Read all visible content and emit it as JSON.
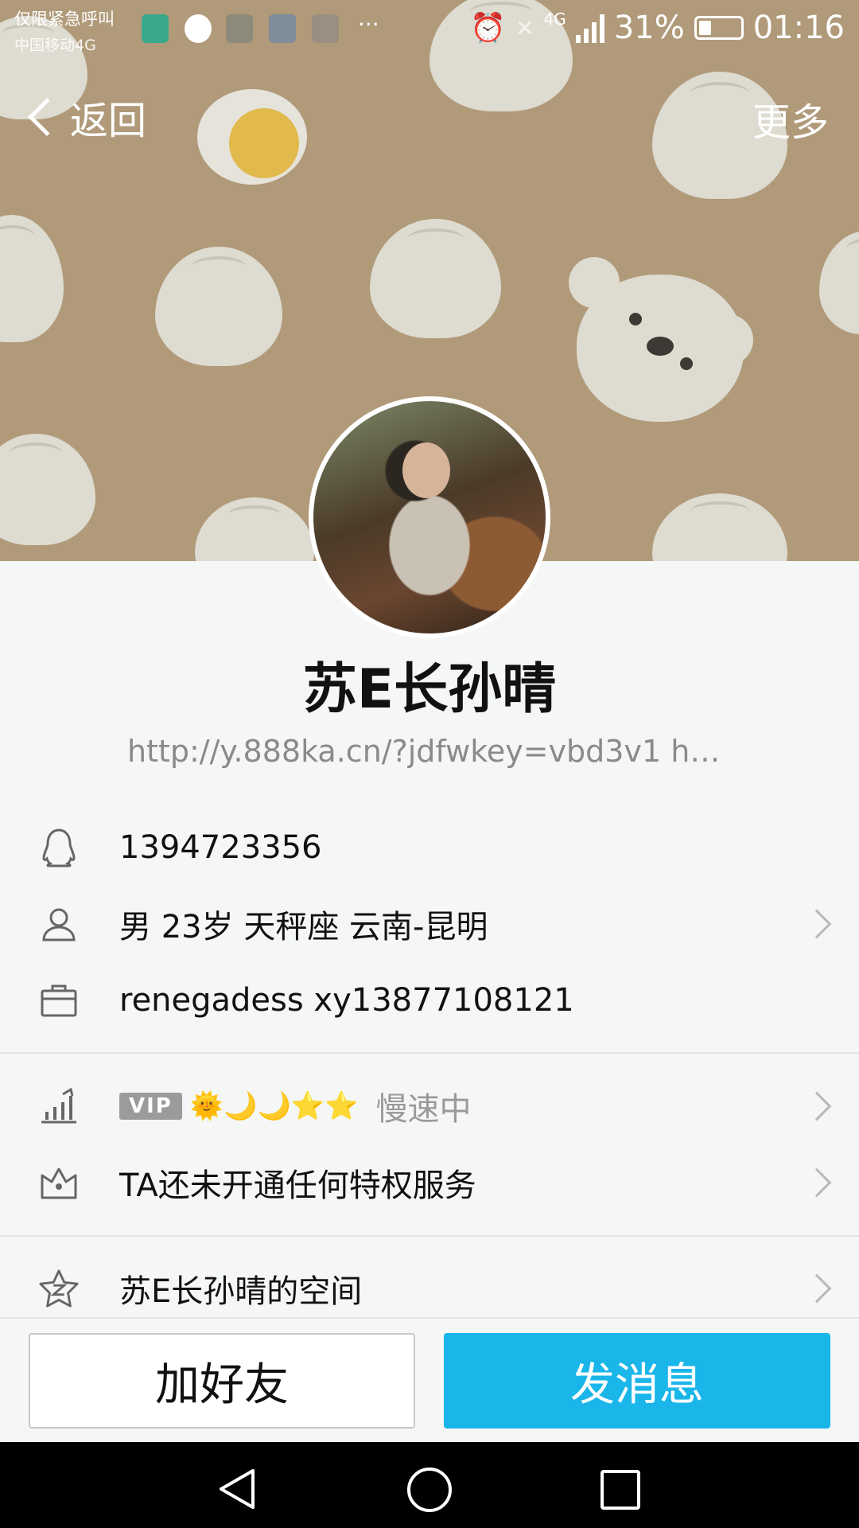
{
  "status_bar": {
    "carrier_line1": "仅限紧急呼叫",
    "carrier_line2": "中国移动4G",
    "more_notifications": "···",
    "network": "4G",
    "battery": "31%",
    "battery_level": 0.31,
    "time": "01:16"
  },
  "nav": {
    "back_label": "返回",
    "more_label": "更多"
  },
  "profile": {
    "name": "苏E长孙晴",
    "signature": "http://y.888ka.cn/?jdfwkey=vbd3v1  htt…"
  },
  "info": {
    "qq_number": "1394723356",
    "personal": "男  23岁  天秤座  云南-昆明",
    "work": "renegadess  xy13877108121"
  },
  "vip": {
    "badge": "VIP",
    "level_icons": "🌞🌙🌙⭐⭐",
    "status": "慢速中"
  },
  "privilege": {
    "text": "TA还未开通任何特权服务"
  },
  "space": {
    "text": "苏E长孙晴的空间"
  },
  "actions": {
    "add_friend": "加好友",
    "send_message": "发消息"
  },
  "colors": {
    "accent": "#1ab6ea",
    "cover": "#b09a7a"
  }
}
